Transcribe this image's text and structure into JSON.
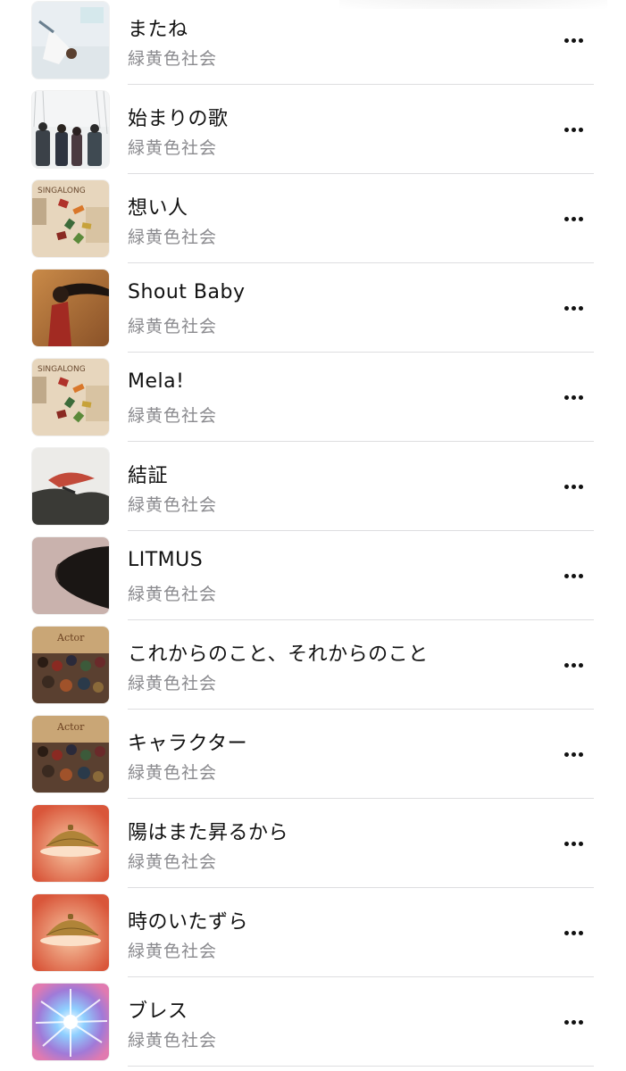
{
  "songs": [
    {
      "title": "またね",
      "artist": "緑黄色社会",
      "art": "mata-ne-cover"
    },
    {
      "title": "始まりの歌",
      "artist": "緑黄色社会",
      "art": "hajimari-no-uta-cover"
    },
    {
      "title": "想い人",
      "artist": "緑黄色社会",
      "art": "singalong-cover"
    },
    {
      "title": "Shout Baby",
      "artist": "緑黄色社会",
      "art": "shout-baby-cover"
    },
    {
      "title": "Mela!",
      "artist": "緑黄色社会",
      "art": "singalong-cover"
    },
    {
      "title": "結証",
      "artist": "緑黄色社会",
      "art": "kessho-cover"
    },
    {
      "title": "LITMUS",
      "artist": "緑黄色社会",
      "art": "litmus-cover"
    },
    {
      "title": "これからのこと、それからのこと",
      "artist": "緑黄色社会",
      "art": "actor-cover"
    },
    {
      "title": "キャラクター",
      "artist": "緑黄色社会",
      "art": "actor-cover"
    },
    {
      "title": "陽はまた昇るから",
      "artist": "緑黄色社会",
      "art": "cloche-cover"
    },
    {
      "title": "時のいたずら",
      "artist": "緑黄色社会",
      "art": "cloche-cover"
    },
    {
      "title": "ブレス",
      "artist": "緑黄色社会",
      "art": "bless-cover"
    }
  ],
  "more_icon": "ellipsis-icon"
}
